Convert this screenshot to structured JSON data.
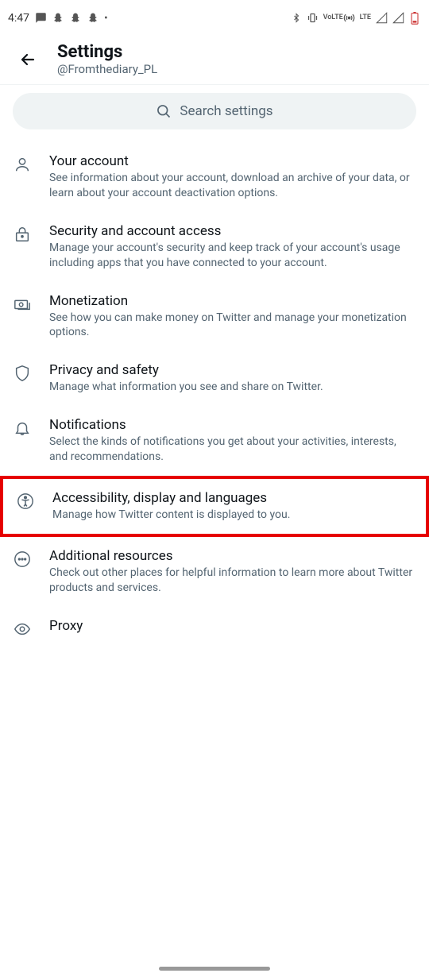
{
  "status_bar": {
    "time": "4:47",
    "lte": "LTE",
    "volte": "VoLTE"
  },
  "header": {
    "title": "Settings",
    "subtitle": "@Fromthediary_PL"
  },
  "search": {
    "placeholder": "Search settings"
  },
  "items": [
    {
      "title": "Your account",
      "desc": "See information about your account, download an archive of your data, or learn about your account deactivation options."
    },
    {
      "title": "Security and account access",
      "desc": "Manage your account's security and keep track of your account's usage including apps that you have connected to your account."
    },
    {
      "title": "Monetization",
      "desc": "See how you can make money on Twitter and manage your monetization options."
    },
    {
      "title": "Privacy and safety",
      "desc": "Manage what information you see and share on Twitter."
    },
    {
      "title": "Notifications",
      "desc": "Select the kinds of notifications you get about your activities, interests, and recommendations."
    },
    {
      "title": "Accessibility, display and languages",
      "desc": "Manage how Twitter content is displayed to you."
    },
    {
      "title": "Additional resources",
      "desc": "Check out other places for helpful information to learn more about Twitter products and services."
    },
    {
      "title": "Proxy",
      "desc": ""
    }
  ]
}
